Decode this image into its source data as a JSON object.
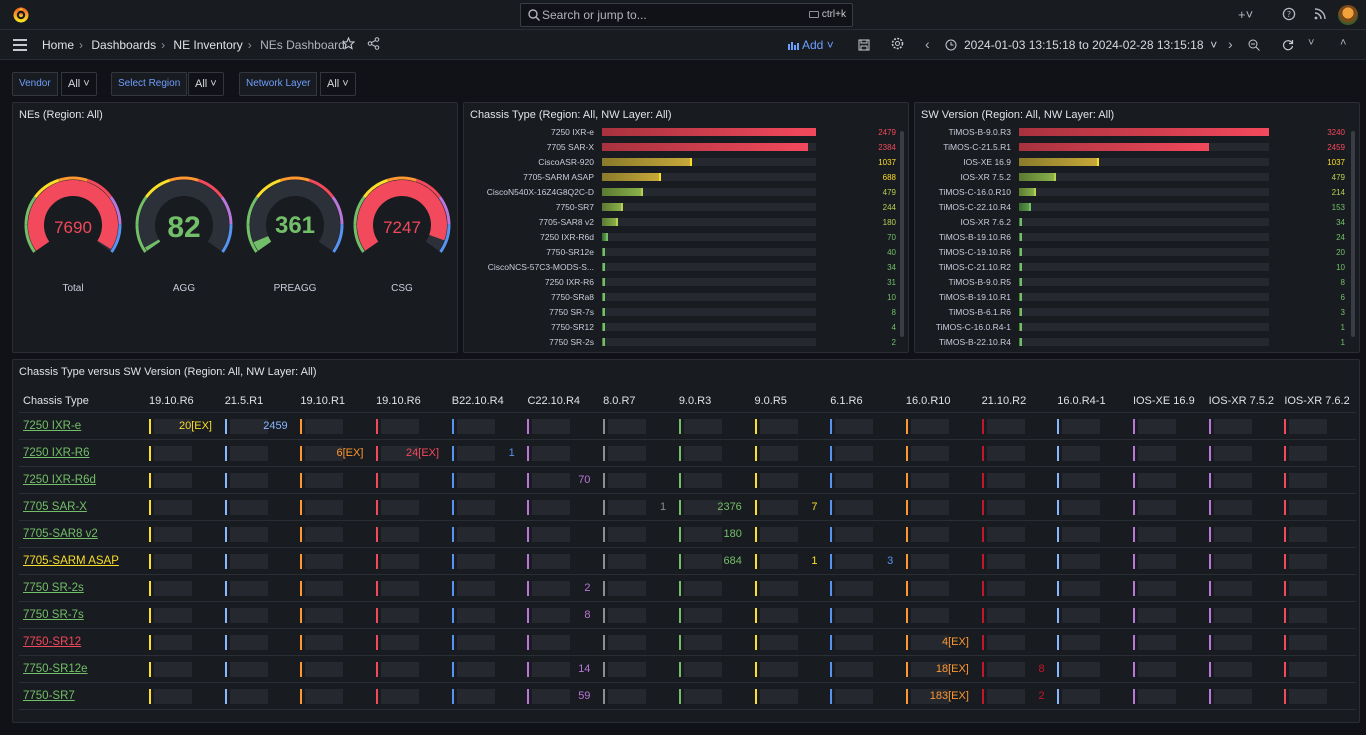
{
  "topbar": {
    "search_placeholder": "Search or jump to...",
    "search_shortcut": "ctrl+k",
    "icons": [
      "grafana-logo-icon",
      "plus-icon",
      "help-icon",
      "rss-icon",
      "user-avatar"
    ]
  },
  "navbar": {
    "breadcrumbs": [
      "Home",
      "Dashboards",
      "NE Inventory",
      "NEs Dashboard"
    ],
    "add_label": "Add",
    "time_range": "2024-01-03 13:15:18 to 2024-02-28 13:15:18"
  },
  "variables": [
    {
      "label": "Vendor",
      "value": "All"
    },
    {
      "label": "Select Region",
      "value": "All"
    },
    {
      "label": "Network Layer",
      "value": "All"
    }
  ],
  "panels": {
    "nes": {
      "title": "NEs (Region: All)",
      "gauges": [
        {
          "label": "Total",
          "value": "7690",
          "fraction": 0.99,
          "color": "#f2495c"
        },
        {
          "label": "AGG",
          "value": "82",
          "fraction": 0.01,
          "color": "#73bf69"
        },
        {
          "label": "PREAGG",
          "value": "361",
          "fraction": 0.05,
          "color": "#73bf69"
        },
        {
          "label": "CSG",
          "value": "7247",
          "fraction": 0.94,
          "color": "#f2495c"
        }
      ]
    },
    "chassis": {
      "title": "Chassis Type (Region: All, NW Layer: All)",
      "max": 2479,
      "rows": [
        {
          "label": "7250 IXR-e",
          "value": "2479"
        },
        {
          "label": "7705 SAR-X",
          "value": "2384"
        },
        {
          "label": "CiscoASR-920",
          "value": "1037"
        },
        {
          "label": "7705-SARM ASAP",
          "value": "688"
        },
        {
          "label": "CiscoN540X-16Z4G8Q2C-D",
          "value": "479"
        },
        {
          "label": "7750-SR7",
          "value": "244"
        },
        {
          "label": "7705-SAR8 v2",
          "value": "180"
        },
        {
          "label": "7250 IXR-R6d",
          "value": "70"
        },
        {
          "label": "7750-SR12e",
          "value": "40"
        },
        {
          "label": "CiscoNCS-57C3-MODS-S...",
          "value": "34"
        },
        {
          "label": "7250 IXR-R6",
          "value": "31"
        },
        {
          "label": "7750-SRa8",
          "value": "10"
        },
        {
          "label": "7750 SR-7s",
          "value": "8"
        },
        {
          "label": "7750-SR12",
          "value": "4"
        },
        {
          "label": "7750 SR-2s",
          "value": "2"
        }
      ]
    },
    "sw": {
      "title": "SW Version (Region: All, NW Layer: All)",
      "max": 3240,
      "rows": [
        {
          "label": "TiMOS-B-9.0.R3",
          "value": "3240"
        },
        {
          "label": "TiMOS-C-21.5.R1",
          "value": "2459"
        },
        {
          "label": "IOS-XE 16.9",
          "value": "1037"
        },
        {
          "label": "IOS-XR 7.5.2",
          "value": "479"
        },
        {
          "label": "TiMOS-C-16.0.R10",
          "value": "214"
        },
        {
          "label": "TiMOS-C-22.10.R4",
          "value": "153"
        },
        {
          "label": "IOS-XR 7.6.2",
          "value": "34"
        },
        {
          "label": "TiMOS-B-19.10.R6",
          "value": "24"
        },
        {
          "label": "TiMOS-C-19.10.R6",
          "value": "20"
        },
        {
          "label": "TiMOS-C-21.10.R2",
          "value": "10"
        },
        {
          "label": "TiMOS-B-9.0.R5",
          "value": "8"
        },
        {
          "label": "TiMOS-B-19.10.R1",
          "value": "6"
        },
        {
          "label": "TiMOS-B-6.1.R6",
          "value": "3"
        },
        {
          "label": "TiMOS-C-16.0.R4-1",
          "value": "1"
        },
        {
          "label": "TiMOS-B-22.10.R4",
          "value": "1"
        }
      ]
    },
    "matrix": {
      "title": "Chassis Type versus SW Version (Region: All, NW Layer: All)",
      "row_header": "Chassis Type",
      "columns": [
        {
          "label": "19.10.R6",
          "color": "#fade2a"
        },
        {
          "label": "21.5.R1",
          "color": "#8ab8ff"
        },
        {
          "label": "19.10.R1",
          "color": "#ff9830"
        },
        {
          "label": "19.10.R6",
          "color": "#f2495c"
        },
        {
          "label": "B22.10.R4",
          "color": "#5794f2"
        },
        {
          "label": "C22.10.R4",
          "color": "#b877d9"
        },
        {
          "label": "8.0.R7",
          "color": "#8e8e8e"
        },
        {
          "label": "9.0.R3",
          "color": "#73bf69"
        },
        {
          "label": "9.0.R5",
          "color": "#fade2a"
        },
        {
          "label": "6.1.R6",
          "color": "#5794f2"
        },
        {
          "label": "16.0.R10",
          "color": "#ff9830"
        },
        {
          "label": "21.10.R2",
          "color": "#c4162a"
        },
        {
          "label": "16.0.R4-1",
          "color": "#8ab8ff"
        },
        {
          "label": "IOS-XE 16.9",
          "color": "#b877d9"
        },
        {
          "label": "IOS-XR 7.5.2",
          "color": "#b877d9"
        },
        {
          "label": "IOS-XR 7.6.2",
          "color": "#f2495c"
        }
      ],
      "rows": [
        {
          "label": "7250 IXR-e",
          "color": "#73bf69",
          "cells": [
            "20[EX]",
            "2459",
            "",
            "",
            "",
            "",
            "",
            "",
            "",
            "",
            "",
            "",
            "",
            "",
            "",
            ""
          ]
        },
        {
          "label": "7250 IXR-R6",
          "color": "#73bf69",
          "cells": [
            "",
            "",
            "6[EX]",
            "24[EX]",
            "1",
            "",
            "",
            "",
            "",
            "",
            "",
            "",
            "",
            "",
            "",
            ""
          ]
        },
        {
          "label": "7250 IXR-R6d",
          "color": "#73bf69",
          "cells": [
            "",
            "",
            "",
            "",
            "",
            "70",
            "",
            "",
            "",
            "",
            "",
            "",
            "",
            "",
            "",
            ""
          ]
        },
        {
          "label": "7705 SAR-X",
          "color": "#73bf69",
          "cells": [
            "",
            "",
            "",
            "",
            "",
            "",
            "1",
            "2376",
            "7",
            "",
            "",
            "",
            "",
            "",
            "",
            ""
          ]
        },
        {
          "label": "7705-SAR8 v2",
          "color": "#73bf69",
          "cells": [
            "",
            "",
            "",
            "",
            "",
            "",
            "",
            "180",
            "",
            "",
            "",
            "",
            "",
            "",
            "",
            ""
          ]
        },
        {
          "label": "7705-SARM ASAP",
          "color": "#fade2a",
          "cells": [
            "",
            "",
            "",
            "",
            "",
            "",
            "",
            "684",
            "1",
            "3",
            "",
            "",
            "",
            "",
            "",
            ""
          ]
        },
        {
          "label": "7750 SR-2s",
          "color": "#73bf69",
          "cells": [
            "",
            "",
            "",
            "",
            "",
            "2",
            "",
            "",
            "",
            "",
            "",
            "",
            "",
            "",
            "",
            ""
          ]
        },
        {
          "label": "7750 SR-7s",
          "color": "#73bf69",
          "cells": [
            "",
            "",
            "",
            "",
            "",
            "8",
            "",
            "",
            "",
            "",
            "",
            "",
            "",
            "",
            "",
            ""
          ]
        },
        {
          "label": "7750-SR12",
          "color": "#f2495c",
          "cells": [
            "",
            "",
            "",
            "",
            "",
            "",
            "",
            "",
            "",
            "",
            "4[EX]",
            "",
            "",
            "",
            "",
            ""
          ]
        },
        {
          "label": "7750-SR12e",
          "color": "#73bf69",
          "cells": [
            "",
            "",
            "",
            "",
            "",
            "14",
            "",
            "",
            "",
            "",
            "18[EX]",
            "8",
            "",
            "",
            "",
            ""
          ]
        },
        {
          "label": "7750-SR7",
          "color": "#73bf69",
          "cells": [
            "",
            "",
            "",
            "",
            "",
            "59",
            "",
            "",
            "",
            "",
            "183[EX]",
            "2",
            "",
            "",
            "",
            ""
          ]
        }
      ]
    }
  }
}
